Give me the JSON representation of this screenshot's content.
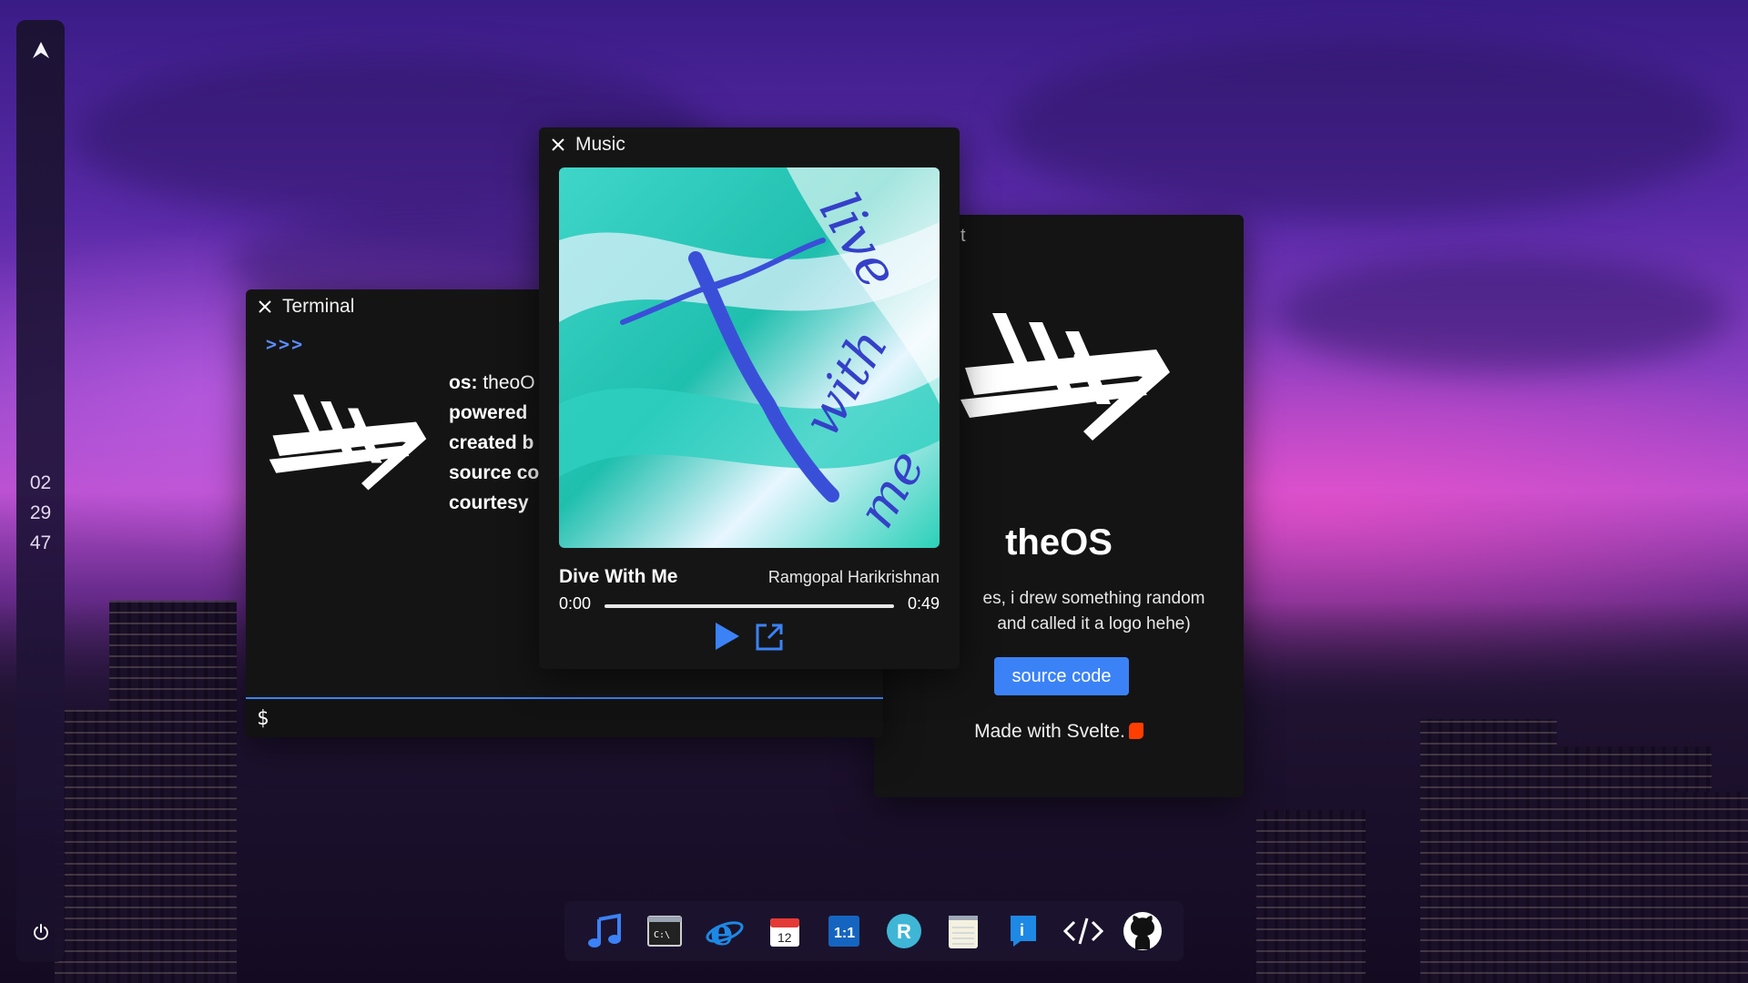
{
  "sidebar": {
    "logo": "A",
    "clock": {
      "hours": "02",
      "minutes": "29",
      "seconds": "47"
    }
  },
  "about_window": {
    "title_fragment": "t",
    "name": "theOS",
    "description_line1": "es, i drew something random",
    "description_line2": "and called it a logo hehe)",
    "button_label": "source code",
    "made_with": "Made with Svelte."
  },
  "terminal_window": {
    "title": "Terminal",
    "prompt": ">>>",
    "info_lines": [
      {
        "key": "os:",
        "value": " theoO"
      },
      {
        "key": "powered",
        "value": ""
      },
      {
        "key": "created b",
        "value": ""
      },
      {
        "key": "source co",
        "value": ""
      },
      {
        "key": "courtesy",
        "value": ""
      }
    ],
    "input_prompt": "$"
  },
  "music_window": {
    "title": "Music",
    "song_title": "Dive With Me",
    "artist": "Ramgopal Harikrishnan",
    "current_time": "0:00",
    "duration": "0:49",
    "progress": 0
  },
  "dock": {
    "items": [
      {
        "name": "music-app-icon"
      },
      {
        "name": "terminal-app-icon"
      },
      {
        "name": "browser-app-icon"
      },
      {
        "name": "calendar-app-icon",
        "text": "12"
      },
      {
        "name": "calculator-app-icon",
        "text": "1:1"
      },
      {
        "name": "r-app-icon",
        "text": "R"
      },
      {
        "name": "notepad-app-icon"
      },
      {
        "name": "about-app-icon",
        "text": "i"
      },
      {
        "name": "code-app-icon",
        "text": "</>"
      },
      {
        "name": "github-app-icon"
      }
    ]
  },
  "colors": {
    "accent": "#3b82f6",
    "window_bg": "#141414",
    "prompt": "#5b8cff"
  }
}
